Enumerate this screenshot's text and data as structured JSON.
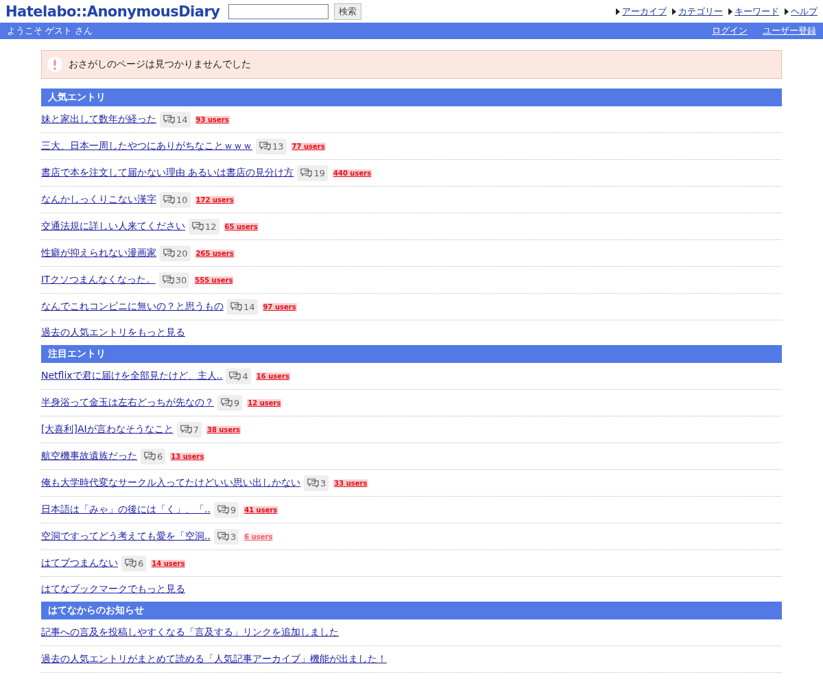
{
  "header": {
    "logo": "Hatelabo::AnonymousDiary",
    "search": {
      "button": "検索"
    },
    "nav": [
      "アーカイブ",
      "カテゴリー",
      "キーワード",
      "ヘルプ"
    ]
  },
  "userbar": {
    "welcome": "ようこそ ゲスト さん",
    "links": [
      "ログイン",
      "ユーザー登録"
    ]
  },
  "alert": {
    "message": "おさがしのページは見つかりませんでした"
  },
  "sections": [
    {
      "title": "人気エントリ",
      "entries": [
        {
          "title": "妹と家出して数年が経った",
          "comments": "14",
          "users": "93 users",
          "kind": "many"
        },
        {
          "title": "三大、日本一周したやつにありがちなことｗｗｗ",
          "comments": "13",
          "users": "77 users",
          "kind": "many"
        },
        {
          "title": "書店で本を注文して届かない理由 あるいは書店の見分け方",
          "comments": "19",
          "users": "440 users",
          "kind": "many"
        },
        {
          "title": "なんかしっくりこない漢字",
          "comments": "10",
          "users": "172 users",
          "kind": "many"
        },
        {
          "title": "交通法規に詳しい人来てください",
          "comments": "12",
          "users": "65 users",
          "kind": "many"
        },
        {
          "title": "性癖が抑えられない漫画家",
          "comments": "20",
          "users": "265 users",
          "kind": "many"
        },
        {
          "title": "ITクソつまんなくなった。",
          "comments": "30",
          "users": "555 users",
          "kind": "many"
        },
        {
          "title": "なんでこれコンビニに無いの？と思うもの",
          "comments": "14",
          "users": "97 users",
          "kind": "many"
        }
      ],
      "more": "過去の人気エントリをもっと見る"
    },
    {
      "title": "注目エントリ",
      "entries": [
        {
          "title": "Netflixで君に届けを全部見たけど、主人..",
          "comments": "4",
          "users": "16 users",
          "kind": "many"
        },
        {
          "title": "半身浴って金玉は左右どっちが先なの？",
          "comments": "9",
          "users": "12 users",
          "kind": "many"
        },
        {
          "title": "[大喜利]AIが言わなそうなこと",
          "comments": "7",
          "users": "38 users",
          "kind": "many"
        },
        {
          "title": "航空機事故遺族だった",
          "comments": "6",
          "users": "13 users",
          "kind": "many"
        },
        {
          "title": "俺も大学時代変なサークル入ってたけどいい思い出しかない",
          "comments": "3",
          "users": "33 users",
          "kind": "many"
        },
        {
          "title": "日本語は「みゃ」の後には「く」、「..",
          "comments": "9",
          "users": "41 users",
          "kind": "many"
        },
        {
          "title": "空洞ですってどう考えても愛を「空洞..",
          "comments": "3",
          "users": "6 users",
          "kind": "few"
        },
        {
          "title": "はてブつまんない",
          "comments": "6",
          "users": "14 users",
          "kind": "many"
        }
      ],
      "more": "はてなブックマークでもっと見る"
    },
    {
      "title": "はてなからのお知らせ",
      "entries": [
        {
          "title": "記事への言及を投稿しやすくなる「言及する」リンクを追加しました"
        },
        {
          "title": "過去の人気エントリがまとめて読める「人気記事アーカイブ」機能が出ました！"
        }
      ]
    }
  ]
}
